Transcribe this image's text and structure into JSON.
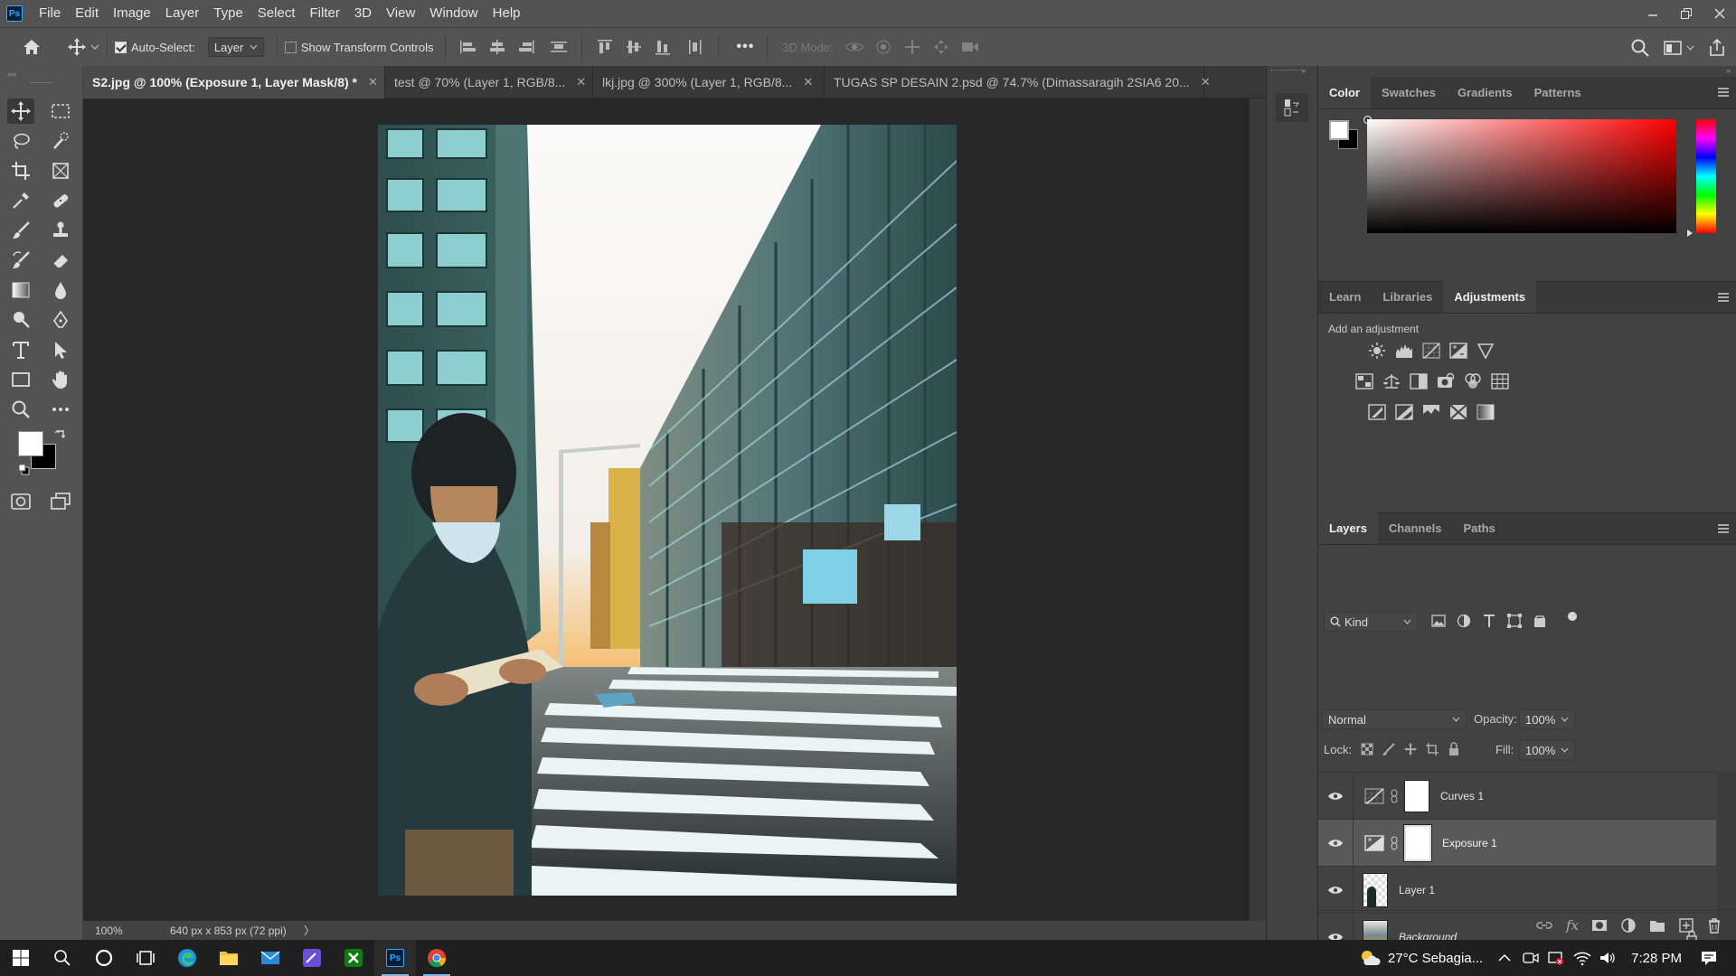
{
  "app": {
    "logo": "Ps"
  },
  "menu": [
    "File",
    "Edit",
    "Image",
    "Layer",
    "Type",
    "Select",
    "Filter",
    "3D",
    "View",
    "Window",
    "Help"
  ],
  "window_controls": [
    "minimize-icon",
    "restore-icon",
    "close-icon"
  ],
  "options": {
    "auto_select_label": "Auto-Select:",
    "auto_select_checked": true,
    "auto_select_value": "Layer",
    "show_transform_label": "Show Transform Controls",
    "show_transform_checked": false,
    "more": "•••",
    "mode3d_label": "3D Mode:"
  },
  "tabs": [
    {
      "label": "S2.jpg @ 100% (Exposure 1, Layer Mask/8) *",
      "active": true
    },
    {
      "label": "test @ 70% (Layer 1, RGB/8...",
      "active": false
    },
    {
      "label": "lkj.jpg @ 300% (Layer 1, RGB/8...",
      "active": false
    },
    {
      "label": "TUGAS SP DESAIN 2.psd @ 74.7% (Dimassaragih 2SIA6 20...",
      "active": false
    }
  ],
  "status": {
    "zoom": "100%",
    "doc_info": "640 px x 853 px (72 ppi)",
    "arrow": "〉"
  },
  "color_panel": {
    "tabs": [
      "Color",
      "Swatches",
      "Gradients",
      "Patterns"
    ],
    "active_tab": "Color",
    "hue_color": "#ff0000",
    "foreground": "#ffffff",
    "background": "#000000"
  },
  "adjust_panel": {
    "tabs": [
      "Learn",
      "Libraries",
      "Adjustments"
    ],
    "active_tab": "Adjustments",
    "title": "Add an adjustment",
    "rows": [
      [
        "brightness-contrast-icon",
        "levels-icon",
        "curves-icon",
        "exposure-icon",
        "vibrance-icon"
      ],
      [
        "hue-saturation-icon",
        "color-balance-icon",
        "black-white-icon",
        "photo-filter-icon",
        "channel-mixer-icon",
        "color-lookup-icon"
      ],
      [
        "invert-icon",
        "posterize-icon",
        "threshold-icon",
        "selective-color-icon",
        "gradient-map-icon"
      ]
    ]
  },
  "layers_panel": {
    "tabs": [
      "Layers",
      "Channels",
      "Paths"
    ],
    "active_tab": "Layers",
    "filter_kind": "Kind",
    "blend_mode": "Normal",
    "opacity_label": "Opacity:",
    "opacity": "100%",
    "lock_label": "Lock:",
    "fill_label": "Fill:",
    "fill": "100%",
    "layers": [
      {
        "name": "Curves 1",
        "type": "adjustment",
        "selected": false,
        "italic": false
      },
      {
        "name": "Exposure 1",
        "type": "adjustment",
        "selected": true,
        "italic": false
      },
      {
        "name": "Layer 1",
        "type": "pixel",
        "selected": false,
        "italic": false
      },
      {
        "name": "Background",
        "type": "background",
        "selected": false,
        "italic": true
      }
    ]
  },
  "taskbar": {
    "weather": "27°C  Sebagia...",
    "time": "7:28 PM"
  }
}
